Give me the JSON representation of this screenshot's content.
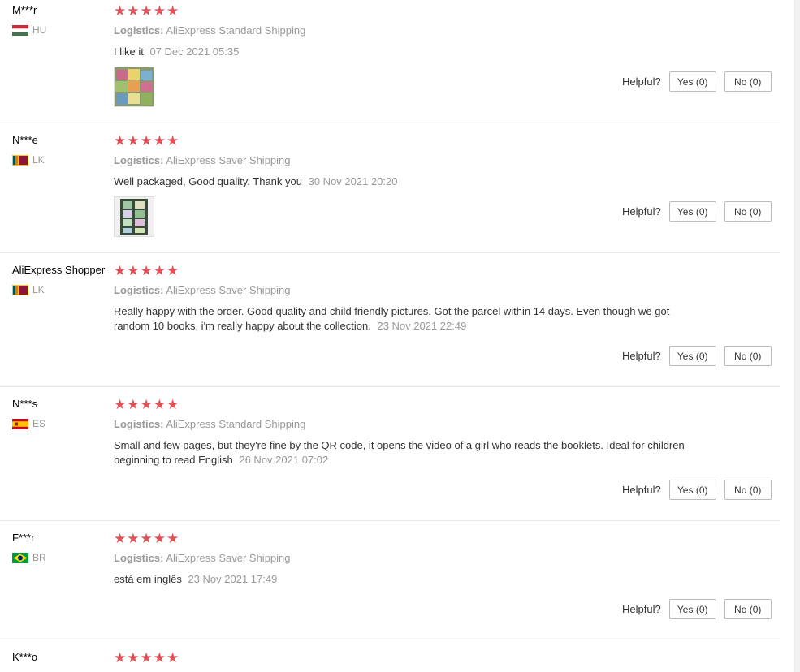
{
  "logistics_label": "Logistics:",
  "helpful_label": "Helpful?",
  "stars_text": "★★★★★",
  "reviews": [
    {
      "user": "M***r",
      "country": "HU",
      "logistics": "AliExpress Standard Shipping",
      "text": "I like it",
      "date": "07 Dec 2021 05:35",
      "yes": "Yes (0)",
      "no": "No (0)"
    },
    {
      "user": "N***e",
      "country": "LK",
      "logistics": "AliExpress Saver Shipping",
      "text": "Well packaged, Good quality. Thank you",
      "date": "30 Nov 2021 20:20",
      "yes": "Yes (0)",
      "no": "No (0)"
    },
    {
      "user": "AliExpress Shopper",
      "country": "LK",
      "logistics": "AliExpress Saver Shipping",
      "text": "Really happy with the order. Good quality and child friendly pictures. Got the parcel within 14 days. Even though we got random 10 books, i'm really happy about the collection.",
      "date": "23 Nov 2021 22:49",
      "yes": "Yes (0)",
      "no": "No (0)"
    },
    {
      "user": "N***s",
      "country": "ES",
      "logistics": "AliExpress Standard Shipping",
      "text": "Small and few pages, but they're fine by the QR code, it opens the video of a girl who reads the booklets. Ideal for children beginning to read English",
      "date": "26 Nov 2021 07:02",
      "yes": "Yes (0)",
      "no": "No (0)"
    },
    {
      "user": "F***r",
      "country": "BR",
      "logistics": "AliExpress Saver Shipping",
      "text": "está em inglês",
      "date": "23 Nov 2021 17:49",
      "yes": "Yes (0)",
      "no": "No (0)"
    },
    {
      "user": "K***o"
    }
  ]
}
